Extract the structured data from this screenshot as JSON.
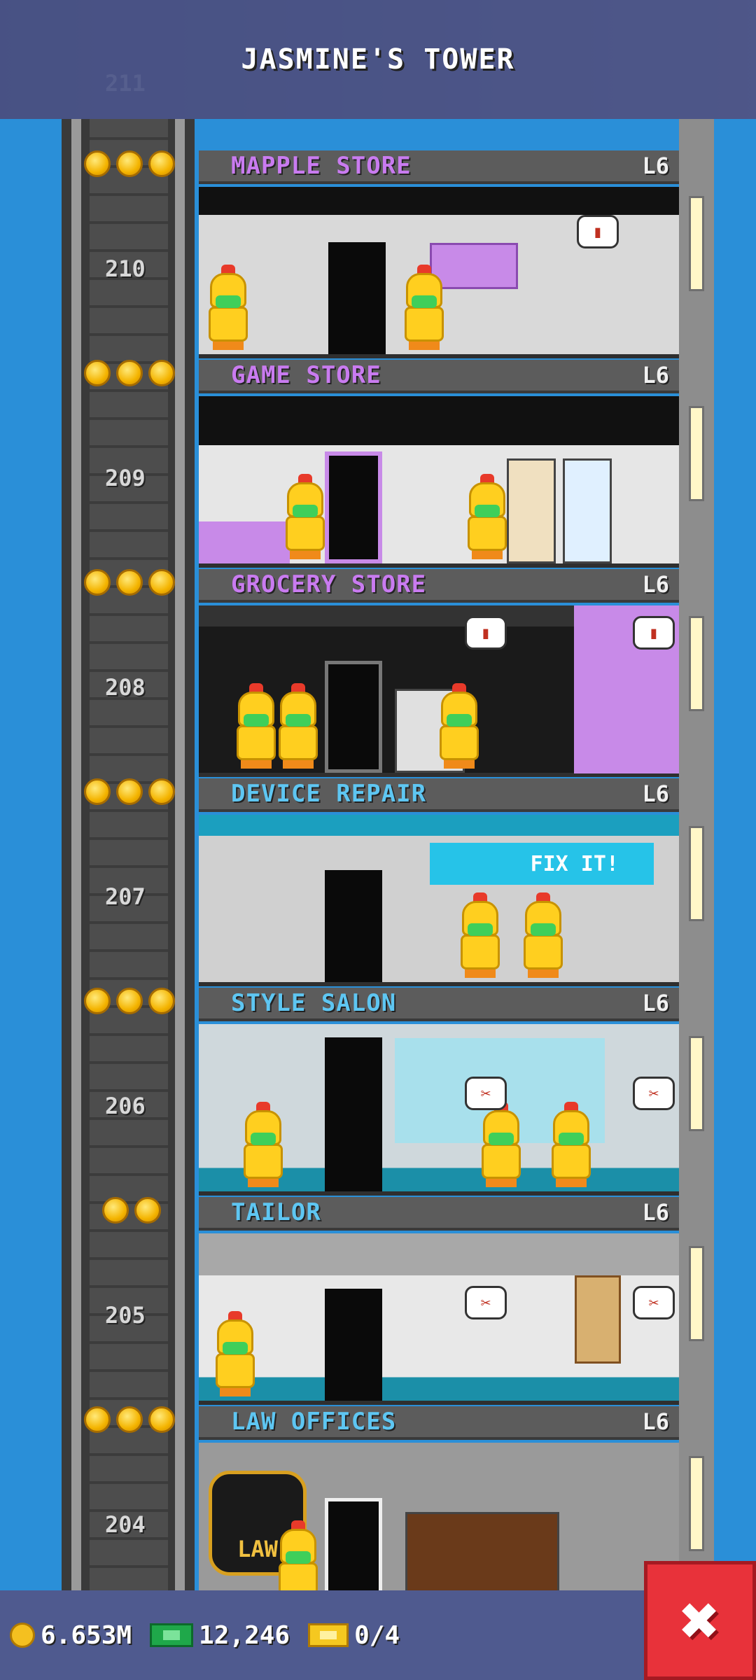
{
  "tower": {
    "title": "JASMINE'S TOWER"
  },
  "top_floor_peek": {
    "number": "211"
  },
  "floors": [
    {
      "number": "210",
      "name": "MAPPLE STORE",
      "level": "L6",
      "stars": 3,
      "name_color": "#c97bf0",
      "room_color": "#d9d9d9"
    },
    {
      "number": "209",
      "name": "GAME STORE",
      "level": "L6",
      "stars": 3,
      "name_color": "#c97bf0",
      "room_color": "#1a1a1a"
    },
    {
      "number": "208",
      "name": "GROCERY STORE",
      "level": "L6",
      "stars": 3,
      "name_color": "#c97bf0",
      "room_color": "#2a2a2a"
    },
    {
      "number": "207",
      "name": "DEVICE REPAIR",
      "level": "L6",
      "stars": 3,
      "name_color": "#5ec6f2",
      "room_color": "#1b9fbf",
      "sign": "FIX IT!"
    },
    {
      "number": "206",
      "name": "STYLE SALON",
      "level": "L6",
      "stars": 3,
      "name_color": "#5ec6f2",
      "room_color": "#cfd8dc"
    },
    {
      "number": "205",
      "name": "TAILOR",
      "level": "L6",
      "stars": 2,
      "name_color": "#5ec6f2",
      "room_color": "#c8c8c8"
    },
    {
      "number": "204",
      "name": "LAW OFFICES",
      "level": "L6",
      "stars": 3,
      "name_color": "#5ec6f2",
      "room_color": "#9a9a9a",
      "sign": "LAW"
    }
  ],
  "status_bar": {
    "coins": "6.653M",
    "bux": "12,246",
    "tickets": "0/4"
  },
  "close_button": {
    "label": "✖"
  },
  "colors": {
    "sky": "#2a8fd8",
    "bar": "#4f5a8f",
    "close": "#e8323a"
  }
}
